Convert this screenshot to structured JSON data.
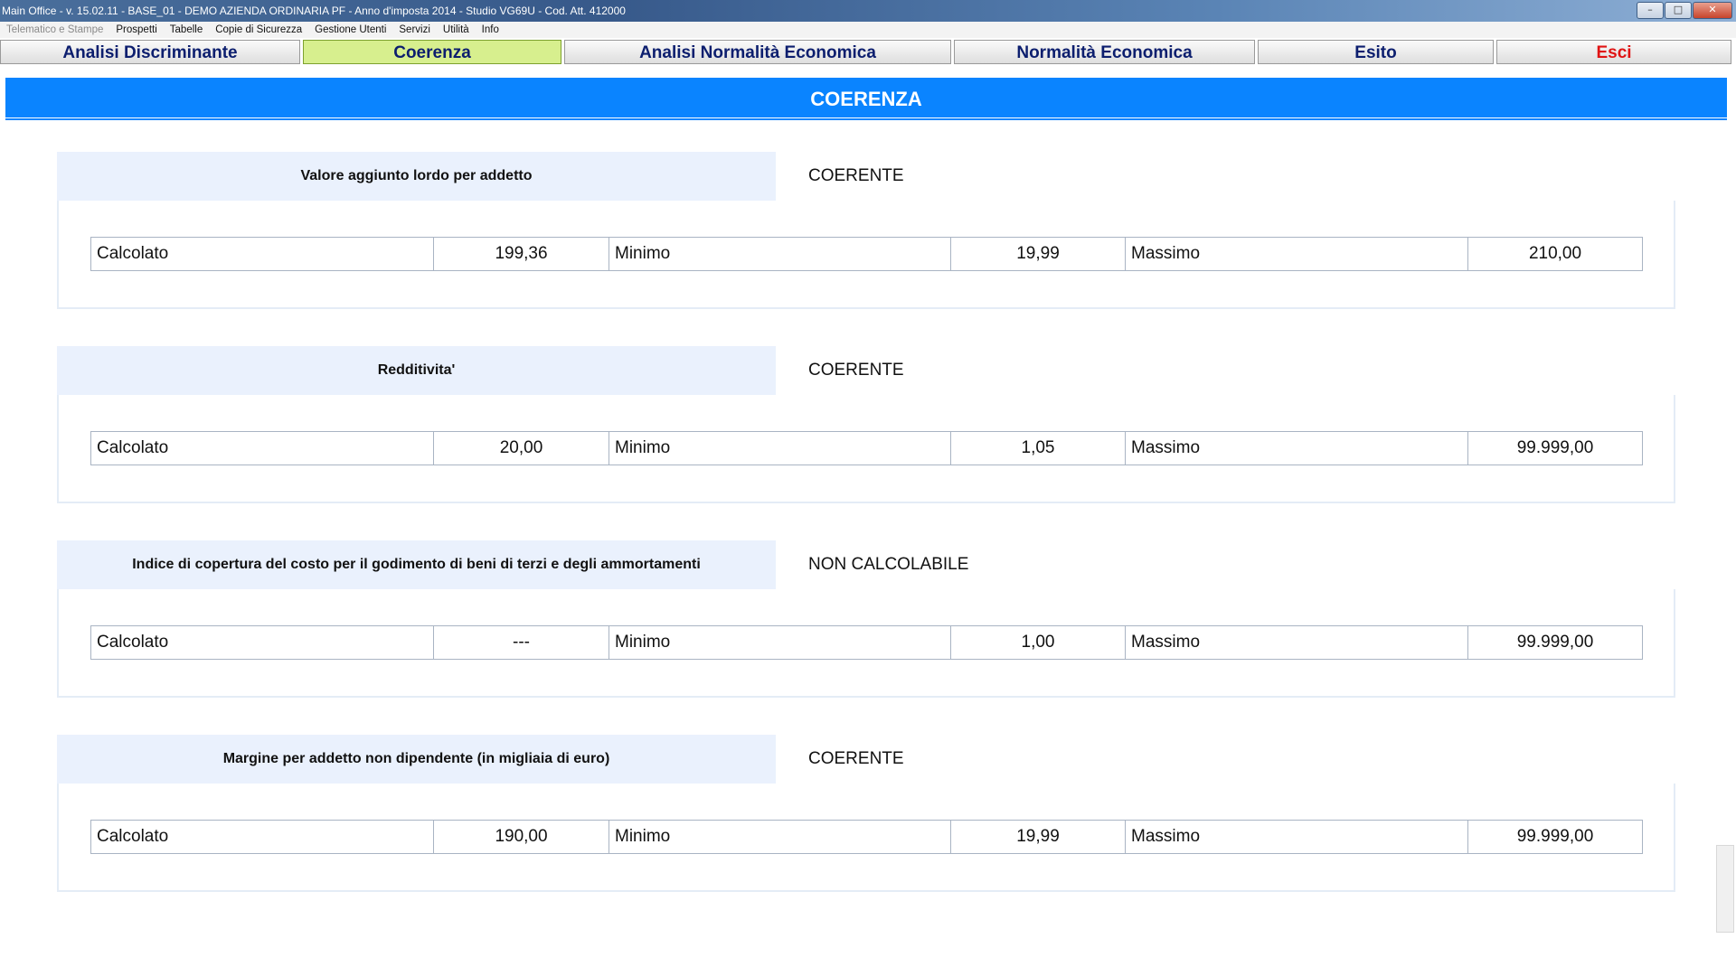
{
  "window": {
    "title": "Main Office - v. 15.02.11 - BASE_01 - DEMO AZIENDA ORDINARIA PF - Anno d'imposta 2014 - Studio VG69U - Cod. Att. 412000"
  },
  "menu": [
    {
      "label": "Telematico e Stampe",
      "disabled": true
    },
    {
      "label": "Prospetti"
    },
    {
      "label": "Tabelle"
    },
    {
      "label": "Copie di Sicurezza"
    },
    {
      "label": "Gestione Utenti"
    },
    {
      "label": "Servizi"
    },
    {
      "label": "Utilità"
    },
    {
      "label": "Info"
    }
  ],
  "tabs": [
    {
      "label": "Analisi Discriminante"
    },
    {
      "label": "Coerenza",
      "active": true
    },
    {
      "label": "Analisi Normalità Economica"
    },
    {
      "label": "Normalità Economica"
    },
    {
      "label": "Esito"
    },
    {
      "label": "Esci"
    }
  ],
  "page": {
    "heading": "COERENZA"
  },
  "sections": [
    {
      "title": "Valore aggiunto lordo per addetto",
      "status": "COERENTE",
      "calcolato_label": "Calcolato",
      "calcolato": "199,36",
      "minimo_label": "Minimo",
      "minimo": "19,99",
      "massimo_label": "Massimo",
      "massimo": "210,00"
    },
    {
      "title": "Redditivita'",
      "status": "COERENTE",
      "calcolato_label": "Calcolato",
      "calcolato": "20,00",
      "minimo_label": "Minimo",
      "minimo": "1,05",
      "massimo_label": "Massimo",
      "massimo": "99.999,00"
    },
    {
      "title": "Indice di copertura del costo per il godimento di beni di terzi e degli ammortamenti",
      "status": "NON CALCOLABILE",
      "calcolato_label": "Calcolato",
      "calcolato": "---",
      "minimo_label": "Minimo",
      "minimo": "1,00",
      "massimo_label": "Massimo",
      "massimo": "99.999,00"
    },
    {
      "title": "Margine per addetto non dipendente (in migliaia di euro)",
      "status": "COERENTE",
      "calcolato_label": "Calcolato",
      "calcolato": "190,00",
      "minimo_label": "Minimo",
      "minimo": "19,99",
      "massimo_label": "Massimo",
      "massimo": "99.999,00"
    }
  ],
  "colors": {
    "banner": "#0a84ff",
    "active_tab": "#d7ef8e",
    "exit_tab_text": "#e01414",
    "tab_text": "#0c1e6e"
  }
}
